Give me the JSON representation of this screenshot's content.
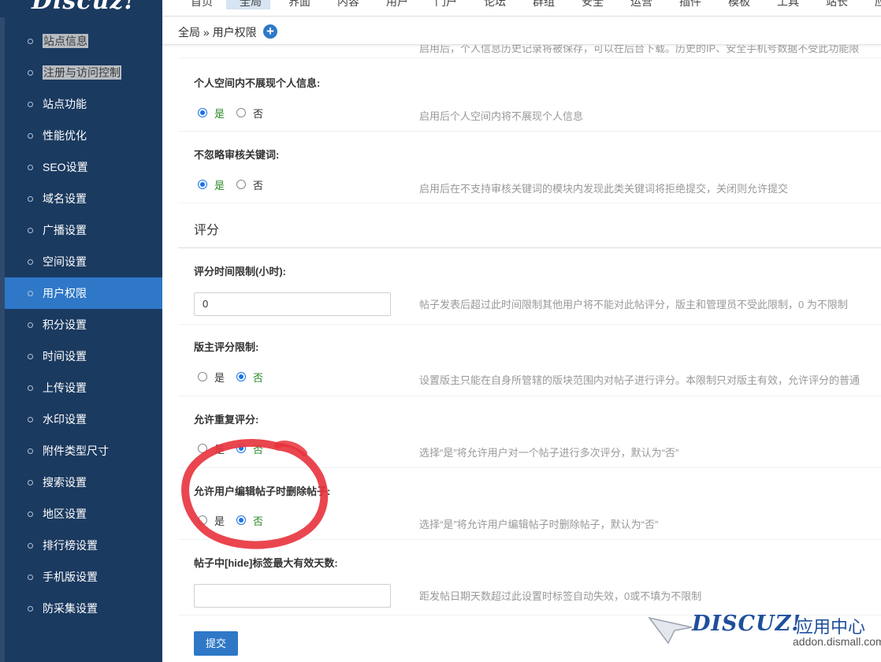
{
  "logo": {
    "text": "Discuz!"
  },
  "top_nav": [
    {
      "label": "首页",
      "active": false
    },
    {
      "label": "全局",
      "active": true
    },
    {
      "label": "界面",
      "active": false
    },
    {
      "label": "内容",
      "active": false
    },
    {
      "label": "用户",
      "active": false
    },
    {
      "label": "门户",
      "active": false
    },
    {
      "label": "论坛",
      "active": false
    },
    {
      "label": "群组",
      "active": false
    },
    {
      "label": "安全",
      "active": false
    },
    {
      "label": "运营",
      "active": false
    },
    {
      "label": "插件",
      "active": false
    },
    {
      "label": "模板",
      "active": false
    },
    {
      "label": "工具",
      "active": false
    },
    {
      "label": "站长",
      "active": false
    },
    {
      "label": "应用",
      "active": false
    }
  ],
  "sidebar": {
    "items": [
      {
        "label": "站点信息",
        "state": "muted"
      },
      {
        "label": "注册与访问控制",
        "state": "muted"
      },
      {
        "label": "站点功能",
        "state": "normal"
      },
      {
        "label": "性能优化",
        "state": "normal"
      },
      {
        "label": "SEO设置",
        "state": "normal"
      },
      {
        "label": "域名设置",
        "state": "normal"
      },
      {
        "label": "广播设置",
        "state": "normal"
      },
      {
        "label": "空间设置",
        "state": "normal"
      },
      {
        "label": "用户权限",
        "state": "active"
      },
      {
        "label": "积分设置",
        "state": "normal"
      },
      {
        "label": "时间设置",
        "state": "normal"
      },
      {
        "label": "上传设置",
        "state": "normal"
      },
      {
        "label": "水印设置",
        "state": "normal"
      },
      {
        "label": "附件类型尺寸",
        "state": "normal"
      },
      {
        "label": "搜索设置",
        "state": "normal"
      },
      {
        "label": "地区设置",
        "state": "normal"
      },
      {
        "label": "排行榜设置",
        "state": "normal"
      },
      {
        "label": "手机版设置",
        "state": "normal"
      },
      {
        "label": "防采集设置",
        "state": "normal"
      }
    ]
  },
  "breadcrumb": {
    "text": "全局 » 用户权限",
    "add_icon": "plus-circle-icon"
  },
  "settings": {
    "cut_desc": "启用后，个人信息历史记录将被保存，可以在后台下载。历史的IP、安全手机号数据不受此功能限",
    "personal_hide": {
      "title": "个人空间内不展现个人信息:",
      "yes": "是",
      "no": "否",
      "value": "是",
      "desc": "启用后个人空间内将不展现个人信息"
    },
    "no_ignore_keywords": {
      "title": "不忽略审核关键词:",
      "yes": "是",
      "no": "否",
      "value": "是",
      "desc": "启用后在不支持审核关键词的模块内发现此类关键词将拒绝提交，关闭则允许提交"
    },
    "section_rating": "评分",
    "rating_time_limit": {
      "title": "评分时间限制(小时):",
      "value": "0",
      "desc": "帖子发表后超过此时间限制其他用户将不能对此帖评分，版主和管理员不受此限制，0 为不限制"
    },
    "moderator_rating_limit": {
      "title": "版主评分限制:",
      "yes": "是",
      "no": "否",
      "value": "否",
      "desc": "设置版主只能在自身所管辖的版块范围内对帖子进行评分。本限制只对版主有效，允许评分的普通"
    },
    "allow_repeat_rating": {
      "title": "允许重复评分:",
      "yes": "是",
      "no": "否",
      "value": "否",
      "desc": "选择“是”将允许用户对一个帖子进行多次评分，默认为“否”"
    },
    "allow_delete_on_edit": {
      "title": "允许用户编辑帖子时删除帖子:",
      "yes": "是",
      "no": "否",
      "value": "否",
      "desc": "选择“是”将允许用户编辑帖子时删除帖子，默认为“否”"
    },
    "hide_tag_days": {
      "title": "帖子中[hide]标签最大有效天数:",
      "value": "",
      "desc": "距发帖日期天数超过此设置时标签自动失效，0或不填为不限制"
    },
    "submit_label": "提交"
  },
  "watermark": {
    "brand": "DISCUZ!",
    "cn": "应用中心",
    "url": "addon.dismall.com"
  },
  "colors": {
    "sidebar_bg": "#1b3a60",
    "sidebar_active": "#2e78c7",
    "button_blue": "#2e78c7",
    "radio_selected": "#1a73e8",
    "selected_label_green": "#2b8a2b",
    "annotation_red": "#e8323c"
  }
}
